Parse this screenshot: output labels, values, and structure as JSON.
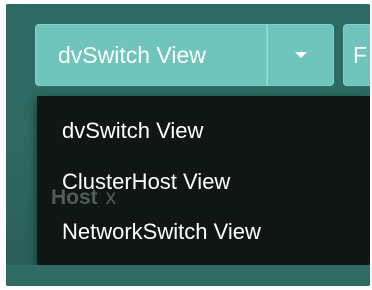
{
  "toolbar": {
    "view_button_label": "dvSwitch View",
    "caret_icon": "chevron-down-icon",
    "clipped_button_label": "F"
  },
  "dropdown": {
    "items": [
      {
        "label": "dvSwitch View"
      },
      {
        "label": "ClusterHost View"
      },
      {
        "label": "NetworkSwitch View"
      }
    ]
  },
  "background_tag": {
    "label": "Host",
    "close_glyph": "x"
  },
  "colors": {
    "panel_bg": "#2d6a64",
    "button_bg": "#6fc5bb",
    "menu_bg": "#101614",
    "text": "#ffffff"
  }
}
